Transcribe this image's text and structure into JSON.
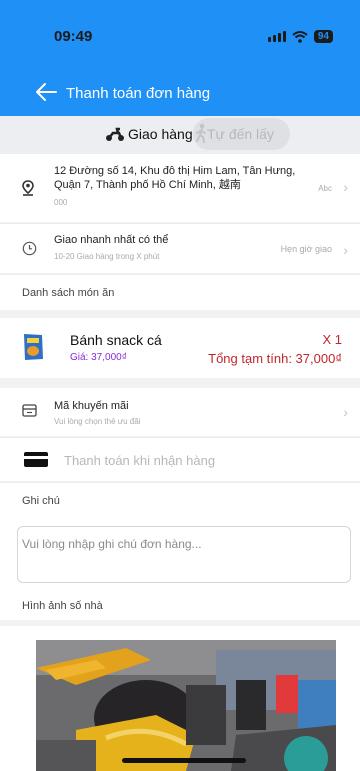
{
  "status_bar": {
    "time": "09:49",
    "battery": "94"
  },
  "nav": {
    "title": "Thanh toán đơn hàng"
  },
  "tabs": {
    "delivery": "Giao hàng",
    "pickup": "Tự đến lấy"
  },
  "address": {
    "text": "12 Đường số 14, Khu đô thị Him Lam, Tân Hưng, Quận 7, Thành phố Hồ Chí Minh, 越南",
    "sub": "000",
    "tag": "Abc"
  },
  "delivery_time": {
    "main": "Giao nhanh nhất có thể",
    "sub": "10-20 Giao hàng trong X phút",
    "right": "Hẹn giờ giao"
  },
  "food_list_label": "Danh sách món ăn",
  "item": {
    "name": "Bánh snack cá",
    "price": "Giá: 37,000₫",
    "qty": "X 1",
    "total": "Tổng tạm tính: 37,000₫"
  },
  "promo": {
    "main": "Mã khuyến mãi",
    "sub": "Vui lòng chọn thẻ ưu đãi"
  },
  "payment": {
    "text": "Thanh toán khi nhận hàng"
  },
  "note": {
    "label": "Ghi chú",
    "placeholder": "Vui lòng nhập ghi chú đơn hàng..."
  },
  "house_photo": {
    "label": "Hình ảnh số nhà"
  },
  "colors": {
    "header": "#1e90f6",
    "price": "#8a2bd6",
    "total": "#c0262d"
  }
}
